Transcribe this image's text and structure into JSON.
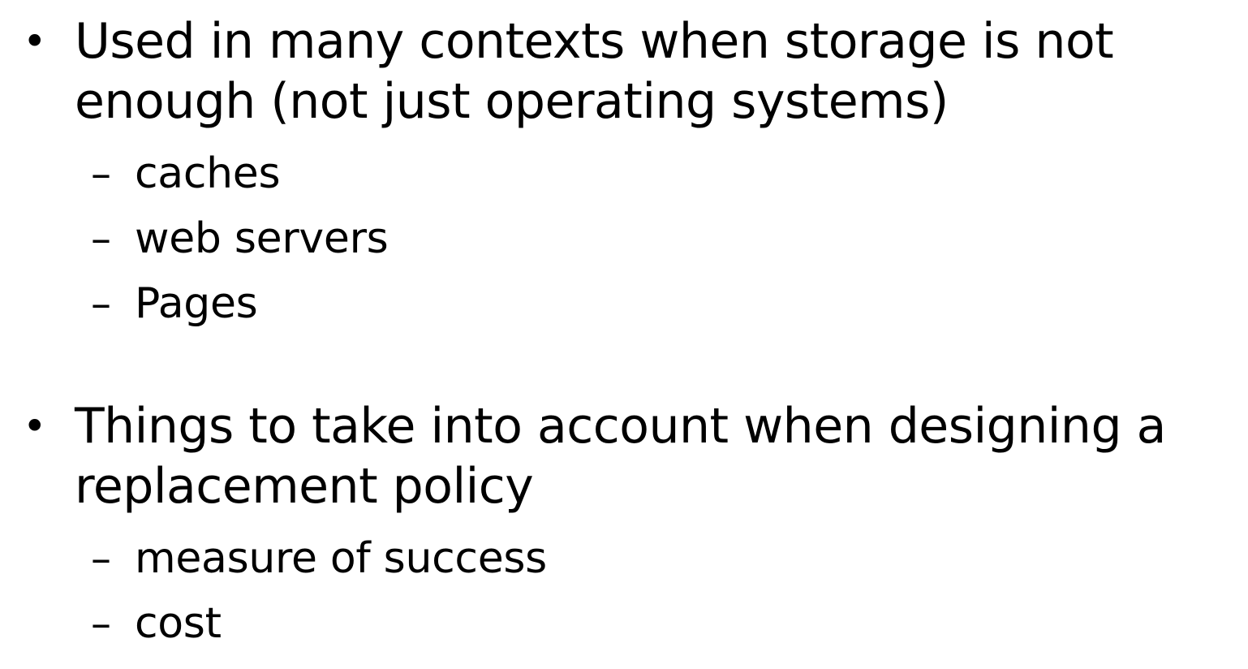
{
  "bullets": [
    {
      "marker": "•",
      "text": "Used in many contexts when storage is not enough (not just operating systems)",
      "sub_items": [
        {
          "dash": "–",
          "text": "caches"
        },
        {
          "dash": "–",
          "text": "web servers"
        },
        {
          "dash": "–",
          "text": "Pages"
        }
      ]
    },
    {
      "marker": "•",
      "text": "Things to take into account when designing a replacement policy",
      "sub_items": [
        {
          "dash": "–",
          "text": "measure of success"
        },
        {
          "dash": "–",
          "text": "cost"
        }
      ]
    }
  ]
}
